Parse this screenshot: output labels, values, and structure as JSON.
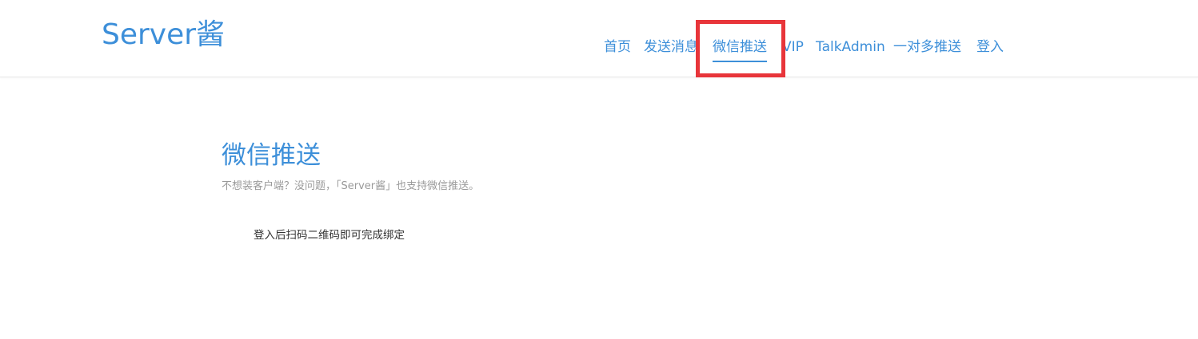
{
  "header": {
    "logo": "Server酱",
    "nav": [
      {
        "label": "首页",
        "active": false
      },
      {
        "label": "发送消息",
        "active": false
      },
      {
        "label": "微信推送",
        "active": true
      },
      {
        "label": "VIP",
        "active": false
      },
      {
        "label": "TalkAdmin",
        "active": false
      },
      {
        "label": "一对多推送",
        "active": false
      },
      {
        "label": "登入",
        "active": false
      }
    ]
  },
  "main": {
    "title": "微信推送",
    "subtitle": "不想装客户端？没问题，「Server酱」也支持微信推送。",
    "instruction": "登入后扫码二维码即可完成绑定"
  },
  "colors": {
    "accent": "#3d8fd9",
    "highlight": "#e8353a",
    "muted_text": "#9a9a9a",
    "body_text": "#333333"
  }
}
